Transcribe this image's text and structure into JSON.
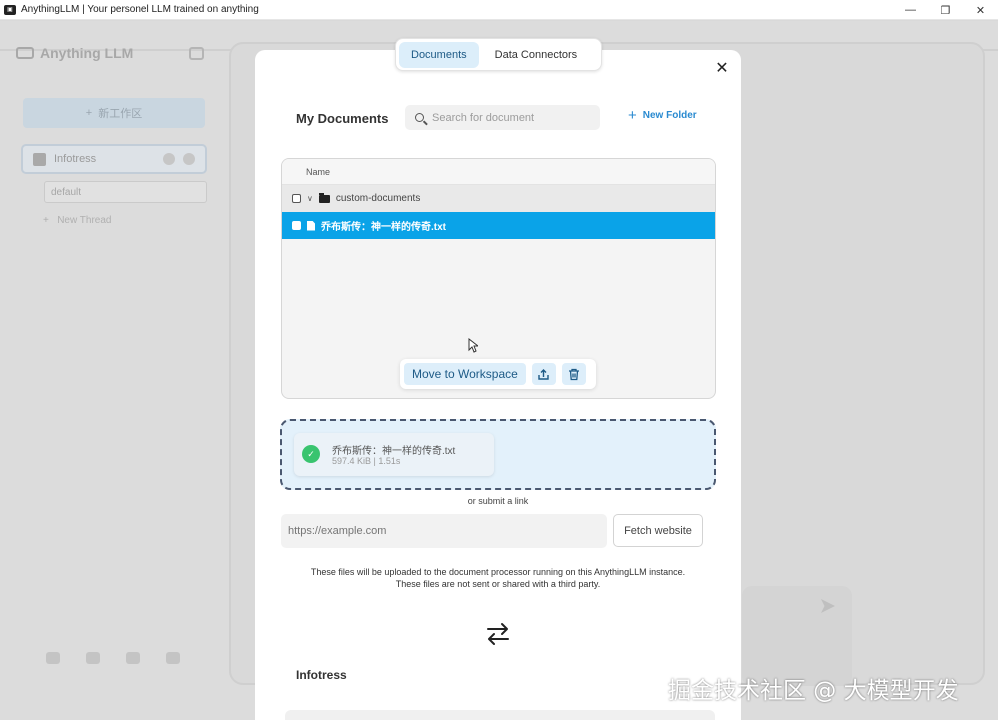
{
  "window": {
    "app_icon": "anything-llm-logo-icon",
    "title": "AnythingLLM | Your personel LLM trained on anything",
    "controls": {
      "minimize": "—",
      "restore": "❐",
      "close": "✕"
    }
  },
  "background": {
    "logo_text": "Anything LLM",
    "new_workspace_label": "新工作区",
    "workspace_name": "Infotress",
    "thread_name": "default",
    "new_thread_label": "New Thread"
  },
  "modal": {
    "tabs": [
      {
        "label": "Documents",
        "active": true
      },
      {
        "label": "Data Connectors",
        "active": false
      }
    ],
    "close_icon": "close-icon",
    "documents_title": "My Documents",
    "search_placeholder": "Search for document",
    "new_folder_label": "New Folder",
    "file_table": {
      "column_header": "Name",
      "folder_name": "custom-documents",
      "selected_file": "乔布斯传：神一样的传奇.txt"
    },
    "actions": {
      "move_label": "Move to Workspace",
      "upload_icon": "upload-icon",
      "delete_icon": "trash-icon"
    },
    "upload": {
      "file_name": "乔布斯传：神一样的传奇.txt",
      "file_meta": "597.4 KiB | 1.51s",
      "status_icon": "check-icon"
    },
    "link_prompt": "or submit a link",
    "url_placeholder": "https://example.com",
    "fetch_label": "Fetch website",
    "notice_line1": "These files will be uploaded to the document processor running on this AnythingLLM instance.",
    "notice_line2": "These files are not sent or shared with a third party.",
    "swap_icon": "swap-arrows-icon",
    "workspace_title": "Infotress"
  },
  "watermark": "掘金技术社区 @ 大模型开发",
  "colors": {
    "accent": "#0aa3e8",
    "tab_active_bg": "#dceefa",
    "success": "#39c46f",
    "dropzone_bg": "#e3f1fb"
  }
}
